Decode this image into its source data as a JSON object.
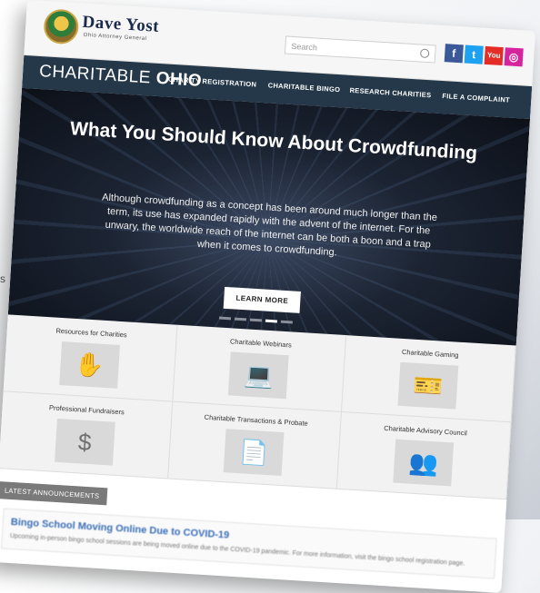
{
  "page": {
    "left_edge_fragment": "s"
  },
  "header": {
    "logo_name": "Dave Yost",
    "logo_subtitle": "Ohio Attorney General",
    "search_placeholder": "Search",
    "social": [
      {
        "label": "f",
        "color": "#3b5998",
        "icon": "facebook-icon"
      },
      {
        "label": "t",
        "color": "#1da1f2",
        "icon": "twitter-icon"
      },
      {
        "label": "You",
        "color": "#e52d27",
        "icon": "youtube-icon"
      },
      {
        "label": "◎",
        "color": "#d6249f",
        "icon": "instagram-icon"
      }
    ]
  },
  "nav": {
    "brand_light": "CHARITABLE",
    "brand_bold": "OHIO",
    "items": [
      "CHARITY REGISTRATION",
      "CHARITABLE BINGO",
      "RESEARCH CHARITIES",
      "FILE A COMPLAINT"
    ]
  },
  "hero": {
    "title": "What You Should Know About Crowdfunding",
    "body": "Although crowdfunding as a concept has been around much longer than the term, its use has expanded rapidly with the advent of the internet. For the unwary, the worldwide reach of the internet can be both a boon and a trap when it comes to crowdfunding.",
    "button": "LEARN MORE",
    "slides_total": 5,
    "slide_active": 4
  },
  "tiles": [
    {
      "label": "Resources for Charities",
      "icon": "hands-circle-icon",
      "glyph": "✋"
    },
    {
      "label": "Charitable Webinars",
      "icon": "laptop-presenter-icon",
      "glyph": "💻"
    },
    {
      "label": "Charitable Gaming",
      "icon": "raffle-ticket-icon",
      "glyph": "🎫"
    },
    {
      "label": "Professional Fundraisers",
      "icon": "hand-dollar-icon",
      "glyph": "$"
    },
    {
      "label": "Charitable Transactions & Probate",
      "icon": "document-icon",
      "glyph": "📄"
    },
    {
      "label": "Charitable Advisory Council",
      "icon": "people-pin-icon",
      "glyph": "👥"
    }
  ],
  "announcements": {
    "heading": "LATEST ANNOUNCEMENTS",
    "title": "Bingo School Moving Online Due to COVID-19",
    "body": "Upcoming in-person bingo school sessions are being moved online due to the COVID-19 pandemic. For more information, visit the bingo school registration page."
  }
}
